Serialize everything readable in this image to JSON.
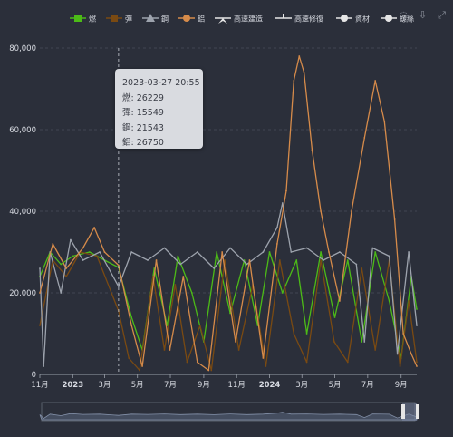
{
  "colors": {
    "background": "#2b2f3a",
    "grid": "#4a4f5c",
    "axis_text": "#d8dbe2"
  },
  "toolbox": {
    "icons": [
      "restore-icon",
      "download-icon",
      "zoom-icon"
    ]
  },
  "tooltip": {
    "datetime": "2023-03-27 20:55",
    "rows": [
      "燃: 26229",
      "彈: 15549",
      "鋼: 21543",
      "鋁: 26750"
    ]
  },
  "chart_data": {
    "type": "line",
    "x_range": [
      "2022-11-01",
      "2024-09-30"
    ],
    "ylim": [
      0,
      80000
    ],
    "y_ticks": [
      "0",
      "20,000",
      "40,000",
      "60,000",
      "80,000"
    ],
    "x_ticks": [
      {
        "label": "11月",
        "date": "2022-11-01",
        "bold": false
      },
      {
        "label": "2023",
        "date": "2023-01-01",
        "bold": true
      },
      {
        "label": "3月",
        "date": "2023-03-01",
        "bold": false
      },
      {
        "label": "5月",
        "date": "2023-05-01",
        "bold": false
      },
      {
        "label": "7月",
        "date": "2023-07-01",
        "bold": false
      },
      {
        "label": "9月",
        "date": "2023-09-01",
        "bold": false
      },
      {
        "label": "11月",
        "date": "2023-11-01",
        "bold": false
      },
      {
        "label": "2024",
        "date": "2024-01-01",
        "bold": true
      },
      {
        "label": "3月",
        "date": "2024-03-01",
        "bold": false
      },
      {
        "label": "5月",
        "date": "2024-05-01",
        "bold": false
      },
      {
        "label": "7月",
        "date": "2024-07-01",
        "bold": false
      },
      {
        "label": "9月",
        "date": "2024-09-01",
        "bold": false
      }
    ],
    "grid": true,
    "legend_position": "top-right",
    "crosshair_date": "2023-03-27",
    "legend": [
      {
        "name": "燃",
        "color": "#4cbb17",
        "marker": "square"
      },
      {
        "name": "彈",
        "color": "#7a4a12",
        "marker": "square"
      },
      {
        "name": "鋼",
        "color": "#9da3ad",
        "marker": "triangle"
      },
      {
        "name": "鋁",
        "color": "#d68b4a",
        "marker": "circle"
      },
      {
        "name": "高速建造",
        "color": "#e6e6e6",
        "marker": "arrow"
      },
      {
        "name": "高速修復",
        "color": "#e6e6e6",
        "marker": "pin"
      },
      {
        "name": "資材",
        "color": "#e6e6e6",
        "marker": "circle"
      },
      {
        "name": "螺絲",
        "color": "#e6e6e6",
        "marker": "circle"
      }
    ],
    "series": [
      {
        "name": "燃",
        "color": "#4cbb17",
        "points": [
          [
            "2022-11-01",
            24000
          ],
          [
            "2022-11-20",
            30000
          ],
          [
            "2022-12-10",
            27000
          ],
          [
            "2023-01-01",
            29000
          ],
          [
            "2023-02-01",
            30000
          ],
          [
            "2023-03-01",
            28000
          ],
          [
            "2023-03-27",
            26229
          ],
          [
            "2023-04-20",
            14000
          ],
          [
            "2023-05-10",
            6000
          ],
          [
            "2023-06-01",
            26000
          ],
          [
            "2023-06-25",
            12000
          ],
          [
            "2023-07-15",
            29000
          ],
          [
            "2023-08-10",
            20000
          ],
          [
            "2023-09-01",
            8000
          ],
          [
            "2023-09-25",
            30000
          ],
          [
            "2023-10-20",
            15000
          ],
          [
            "2023-11-15",
            28000
          ],
          [
            "2023-12-10",
            12000
          ],
          [
            "2024-01-01",
            30000
          ],
          [
            "2024-01-25",
            20000
          ],
          [
            "2024-02-20",
            28000
          ],
          [
            "2024-03-10",
            10000
          ],
          [
            "2024-04-05",
            30000
          ],
          [
            "2024-05-01",
            14000
          ],
          [
            "2024-05-25",
            28000
          ],
          [
            "2024-06-20",
            8000
          ],
          [
            "2024-07-15",
            30000
          ],
          [
            "2024-08-10",
            18000
          ],
          [
            "2024-09-01",
            4000
          ],
          [
            "2024-09-20",
            24000
          ],
          [
            "2024-09-30",
            16000
          ]
        ]
      },
      {
        "name": "彈",
        "color": "#7a4a12",
        "points": [
          [
            "2022-11-01",
            12000
          ],
          [
            "2022-11-25",
            28000
          ],
          [
            "2022-12-20",
            24000
          ],
          [
            "2023-01-15",
            30000
          ],
          [
            "2023-02-15",
            29000
          ],
          [
            "2023-03-27",
            15549
          ],
          [
            "2023-04-15",
            4000
          ],
          [
            "2023-05-05",
            1000
          ],
          [
            "2023-05-30",
            24000
          ],
          [
            "2023-06-20",
            6000
          ],
          [
            "2023-07-10",
            22000
          ],
          [
            "2023-08-01",
            3000
          ],
          [
            "2023-08-25",
            12000
          ],
          [
            "2023-09-15",
            1000
          ],
          [
            "2023-10-10",
            28000
          ],
          [
            "2023-11-05",
            6000
          ],
          [
            "2023-12-01",
            22000
          ],
          [
            "2023-12-25",
            2000
          ],
          [
            "2024-01-20",
            28000
          ],
          [
            "2024-02-15",
            10000
          ],
          [
            "2024-03-10",
            3000
          ],
          [
            "2024-04-05",
            28000
          ],
          [
            "2024-04-30",
            8000
          ],
          [
            "2024-05-25",
            3000
          ],
          [
            "2024-06-20",
            26000
          ],
          [
            "2024-07-15",
            6000
          ],
          [
            "2024-08-10",
            28000
          ],
          [
            "2024-08-30",
            2000
          ],
          [
            "2024-09-15",
            18000
          ],
          [
            "2024-09-30",
            3000
          ]
        ]
      },
      {
        "name": "鋼",
        "color": "#9da3ad",
        "points": [
          [
            "2022-11-01",
            26000
          ],
          [
            "2022-11-08",
            2000
          ],
          [
            "2022-11-20",
            30000
          ],
          [
            "2022-12-10",
            20000
          ],
          [
            "2022-12-28",
            33000
          ],
          [
            "2023-01-20",
            28000
          ],
          [
            "2023-02-20",
            30000
          ],
          [
            "2023-03-27",
            21543
          ],
          [
            "2023-04-20",
            30000
          ],
          [
            "2023-05-20",
            28000
          ],
          [
            "2023-06-20",
            31000
          ],
          [
            "2023-07-20",
            27000
          ],
          [
            "2023-08-20",
            30000
          ],
          [
            "2023-09-20",
            26000
          ],
          [
            "2023-10-20",
            31000
          ],
          [
            "2023-11-20",
            27000
          ],
          [
            "2023-12-20",
            30000
          ],
          [
            "2024-01-15",
            36000
          ],
          [
            "2024-01-25",
            42000
          ],
          [
            "2024-02-10",
            30000
          ],
          [
            "2024-03-10",
            31000
          ],
          [
            "2024-04-10",
            28000
          ],
          [
            "2024-05-10",
            30000
          ],
          [
            "2024-06-10",
            27000
          ],
          [
            "2024-06-25",
            8000
          ],
          [
            "2024-07-10",
            31000
          ],
          [
            "2024-08-10",
            29000
          ],
          [
            "2024-08-25",
            5000
          ],
          [
            "2024-09-15",
            30000
          ],
          [
            "2024-09-30",
            12000
          ]
        ]
      },
      {
        "name": "鋁",
        "color": "#d68b4a",
        "points": [
          [
            "2022-11-01",
            20000
          ],
          [
            "2022-11-25",
            32000
          ],
          [
            "2022-12-20",
            26000
          ],
          [
            "2023-01-20",
            31000
          ],
          [
            "2023-02-10",
            36000
          ],
          [
            "2023-03-01",
            30000
          ],
          [
            "2023-03-27",
            26750
          ],
          [
            "2023-04-20",
            12000
          ],
          [
            "2023-05-10",
            2000
          ],
          [
            "2023-06-05",
            28000
          ],
          [
            "2023-06-30",
            6000
          ],
          [
            "2023-07-25",
            24000
          ],
          [
            "2023-08-20",
            3000
          ],
          [
            "2023-09-10",
            1000
          ],
          [
            "2023-10-05",
            30000
          ],
          [
            "2023-10-30",
            8000
          ],
          [
            "2023-11-25",
            28000
          ],
          [
            "2023-12-20",
            4000
          ],
          [
            "2024-01-15",
            32000
          ],
          [
            "2024-02-01",
            45000
          ],
          [
            "2024-02-15",
            72000
          ],
          [
            "2024-02-25",
            78000
          ],
          [
            "2024-03-05",
            74000
          ],
          [
            "2024-03-20",
            55000
          ],
          [
            "2024-04-05",
            40000
          ],
          [
            "2024-04-20",
            30000
          ],
          [
            "2024-05-10",
            18000
          ],
          [
            "2024-06-01",
            40000
          ],
          [
            "2024-06-25",
            58000
          ],
          [
            "2024-07-15",
            72000
          ],
          [
            "2024-08-01",
            62000
          ],
          [
            "2024-08-20",
            38000
          ],
          [
            "2024-09-05",
            10000
          ],
          [
            "2024-09-20",
            5000
          ],
          [
            "2024-09-30",
            2000
          ]
        ]
      }
    ]
  }
}
